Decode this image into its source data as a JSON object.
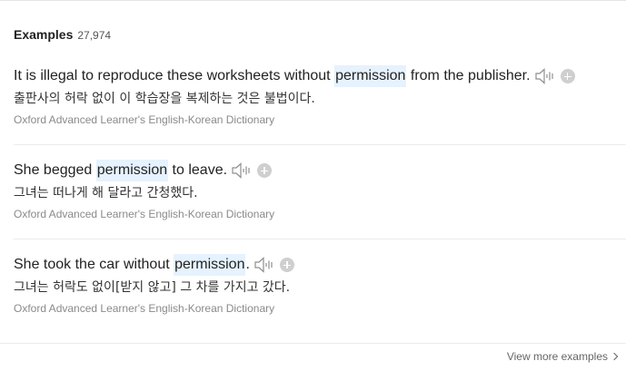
{
  "header": {
    "title": "Examples",
    "count": "27,974"
  },
  "examples": [
    {
      "en_before": "It is illegal to reproduce these worksheets without ",
      "en_highlight": "permission",
      "en_after": " from the publisher.",
      "ko": "출판사의 허락 없이 이 학습장을 복제하는 것은 불법이다.",
      "source": "Oxford Advanced Learner's English-Korean Dictionary"
    },
    {
      "en_before": "She begged ",
      "en_highlight": "permission",
      "en_after": " to leave.",
      "ko": "그녀는 떠나게 해 달라고 간청했다.",
      "source": "Oxford Advanced Learner's English-Korean Dictionary"
    },
    {
      "en_before": "She took the car without ",
      "en_highlight": "permission",
      "en_after": ".",
      "ko": "그녀는 허락도 없이[받지 않고] 그 차를 가지고 갔다.",
      "source": "Oxford Advanced Learner's English-Korean Dictionary"
    }
  ],
  "footer": {
    "more_label": "View more examples"
  },
  "icons": {
    "sound": "speaker-icon",
    "add": "plus-circle-icon",
    "more": "chevron-right-icon"
  },
  "colors": {
    "highlight": "#e6f2fd",
    "icon_gray": "#cfcfcf"
  }
}
